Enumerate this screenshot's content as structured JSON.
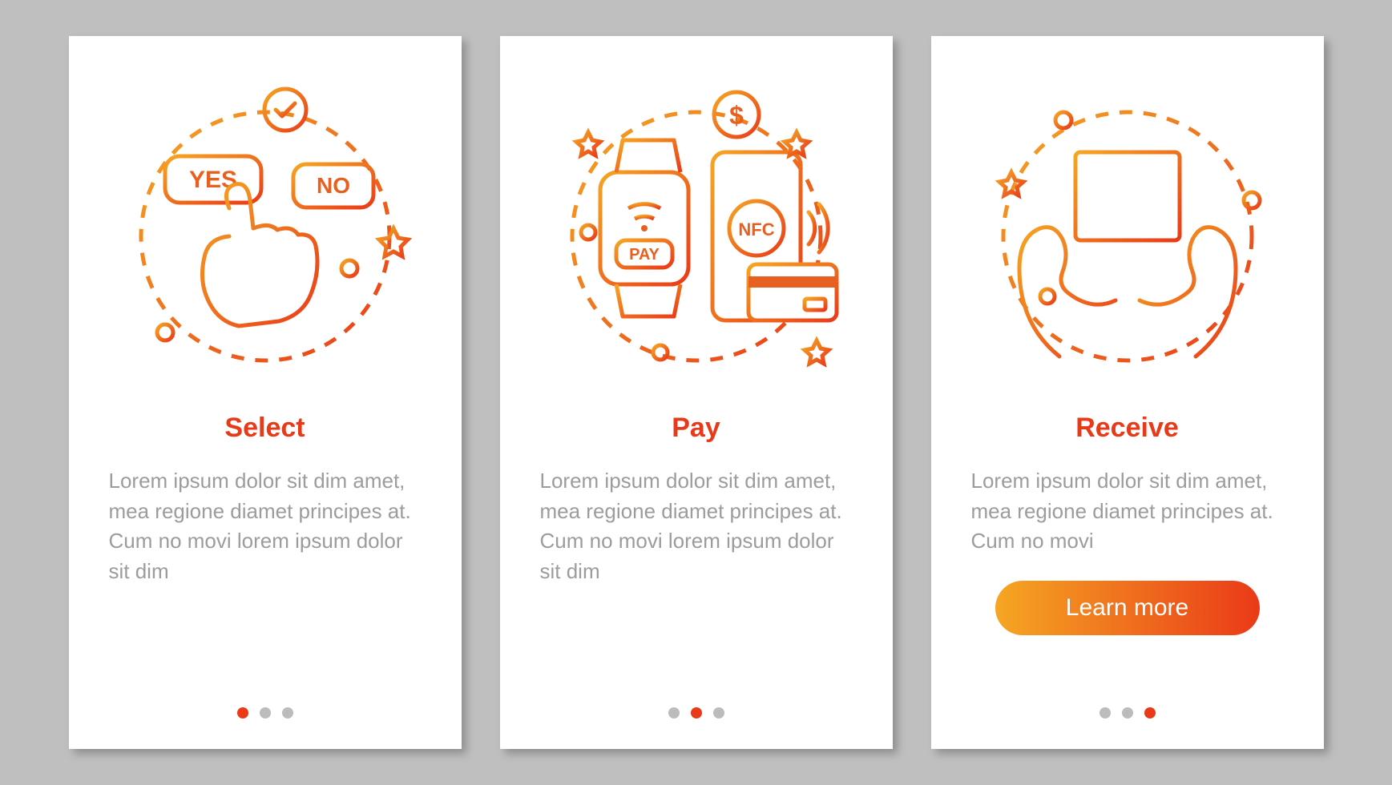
{
  "colors": {
    "accent": "#ea3a18",
    "gradient_start": "#f5a623",
    "gradient_end": "#ea3a18",
    "text_muted": "#9c9c9c",
    "background": "#bfbfbf"
  },
  "cards": [
    {
      "title": "Select",
      "description": "Lorem ipsum dolor sit dim amet, mea regione diamet principes at. Cum no movi lorem ipsum dolor sit dim",
      "illustration": "select-yes-no-hand",
      "icon_labels": {
        "yes": "YES",
        "no": "NO"
      },
      "has_button": false,
      "dots_total": 3,
      "active_dot": 0
    },
    {
      "title": "Pay",
      "description": "Lorem ipsum dolor sit dim amet, mea regione diamet principes at. Cum no movi lorem ipsum dolor sit dim",
      "illustration": "pay-watch-phone-nfc",
      "icon_labels": {
        "pay": "PAY",
        "nfc": "NFC",
        "dollar": "$"
      },
      "has_button": false,
      "dots_total": 3,
      "active_dot": 1
    },
    {
      "title": "Receive",
      "description": "Lorem ipsum dolor sit dim amet, mea regione diamet principes at. Cum no movi",
      "illustration": "receive-hands-package",
      "has_button": true,
      "button_label": "Learn more",
      "dots_total": 3,
      "active_dot": 2
    }
  ]
}
